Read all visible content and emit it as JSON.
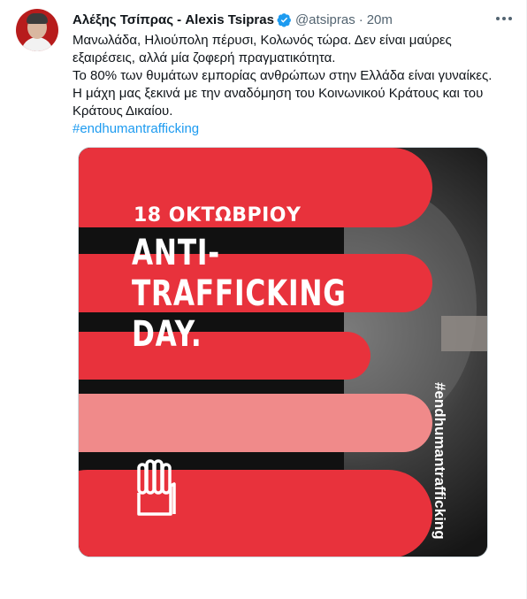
{
  "author": {
    "name": "Αλέξης Τσίπρας - Alexis Tsipras",
    "handle": "@atsipras",
    "separator": "·",
    "time": "20m",
    "verified_icon": "verified-badge-icon",
    "avatar_icon": "avatar"
  },
  "tweet": {
    "lines": [
      "Μανωλάδα, Ηλιούπολη πέρυσι, Κολωνός τώρα. Δεν είναι μαύρες εξαιρέσεις, αλλά μία ζοφερή πραγματικότητα.",
      "Το 80% των θυμάτων εμπορίας ανθρώπων στην Ελλάδα είναι γυναίκες.",
      "Η μάχη μας ξεκινά με την αναδόμηση του Κοινωνικού Κράτους και του Κράτους Δικαίου."
    ],
    "hashtag": "#endhumantrafficking"
  },
  "poster": {
    "date": "18 ΟΚΤΩΒΡΙΟΥ",
    "headline": "ANTI-\nTRAFFICKING\nDAY.",
    "vertical_hashtag": "#endhumantrafficking",
    "colors": {
      "red": "#e8323c",
      "pink": "#f08a8a",
      "dark": "#111111"
    },
    "icon": "raised-hand-icon"
  },
  "colors": {
    "accent": "#1d9bf0",
    "text": "#0f1419",
    "muted": "#536471"
  }
}
